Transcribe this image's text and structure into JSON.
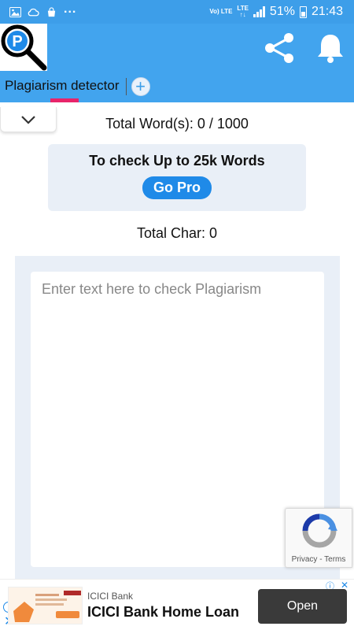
{
  "status_bar": {
    "volte": "Vo) LTE",
    "lte": "LTE",
    "battery": "51%",
    "time": "21:43",
    "dots": "..."
  },
  "header": {
    "tab_label": "Plagiarism detector",
    "add_tab": "+",
    "accent_color": "#42a4ee",
    "tab_indicator_color": "#e8246a"
  },
  "main": {
    "word_count": "Total Word(s): 0 / 1000",
    "pro_text": "To check Up to 25k Words",
    "pro_button": "Go Pro",
    "char_count": "Total Char: 0",
    "text_placeholder": "Enter text here to check Plagiarism"
  },
  "recaptcha": {
    "links": "Privacy - Terms"
  },
  "ad": {
    "brand": "ICICI Bank",
    "title": "ICICI Bank Home Loan",
    "cta": "Open"
  }
}
